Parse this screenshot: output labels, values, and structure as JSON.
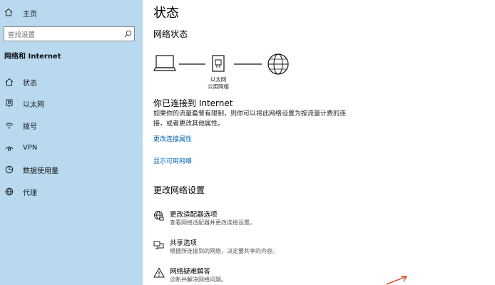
{
  "sidebar": {
    "home_label": "主页",
    "search_placeholder": "查找设置",
    "section_title": "网络和 Internet",
    "items": [
      {
        "label": "状态",
        "icon": "home-icon"
      },
      {
        "label": "以太网",
        "icon": "ethernet-icon"
      },
      {
        "label": "拨号",
        "icon": "dialup-icon"
      },
      {
        "label": "VPN",
        "icon": "vpn-icon"
      },
      {
        "label": "数据使用量",
        "icon": "data-usage-icon"
      },
      {
        "label": "代理",
        "icon": "globe-icon"
      }
    ]
  },
  "main": {
    "title": "状态",
    "network_status_heading": "网络状态",
    "diagram": {
      "adapter_line1": "以太网",
      "adapter_line2": "公用网络"
    },
    "connected_title": "你已连接到 Internet",
    "connected_desc": "如果你的流量套餐有限制，则你可以将此网络设置为按流量计费的连接，或者更改其他属性。",
    "link_change_props": "更改连接属性",
    "link_show_networks": "显示可用网络",
    "change_settings_heading": "更改网络设置",
    "options": [
      {
        "title": "更改适配器选项",
        "desc": "查看网络适配器并更改连接设置。"
      },
      {
        "title": "共享选项",
        "desc": "根据所连接到的网络，决定要共享的内容。"
      },
      {
        "title": "网络疑难解答",
        "desc": "诊断并解决网络问题。"
      }
    ]
  },
  "colors": {
    "sidebar_bg": "#b8d9ee",
    "link": "#0063b1"
  }
}
